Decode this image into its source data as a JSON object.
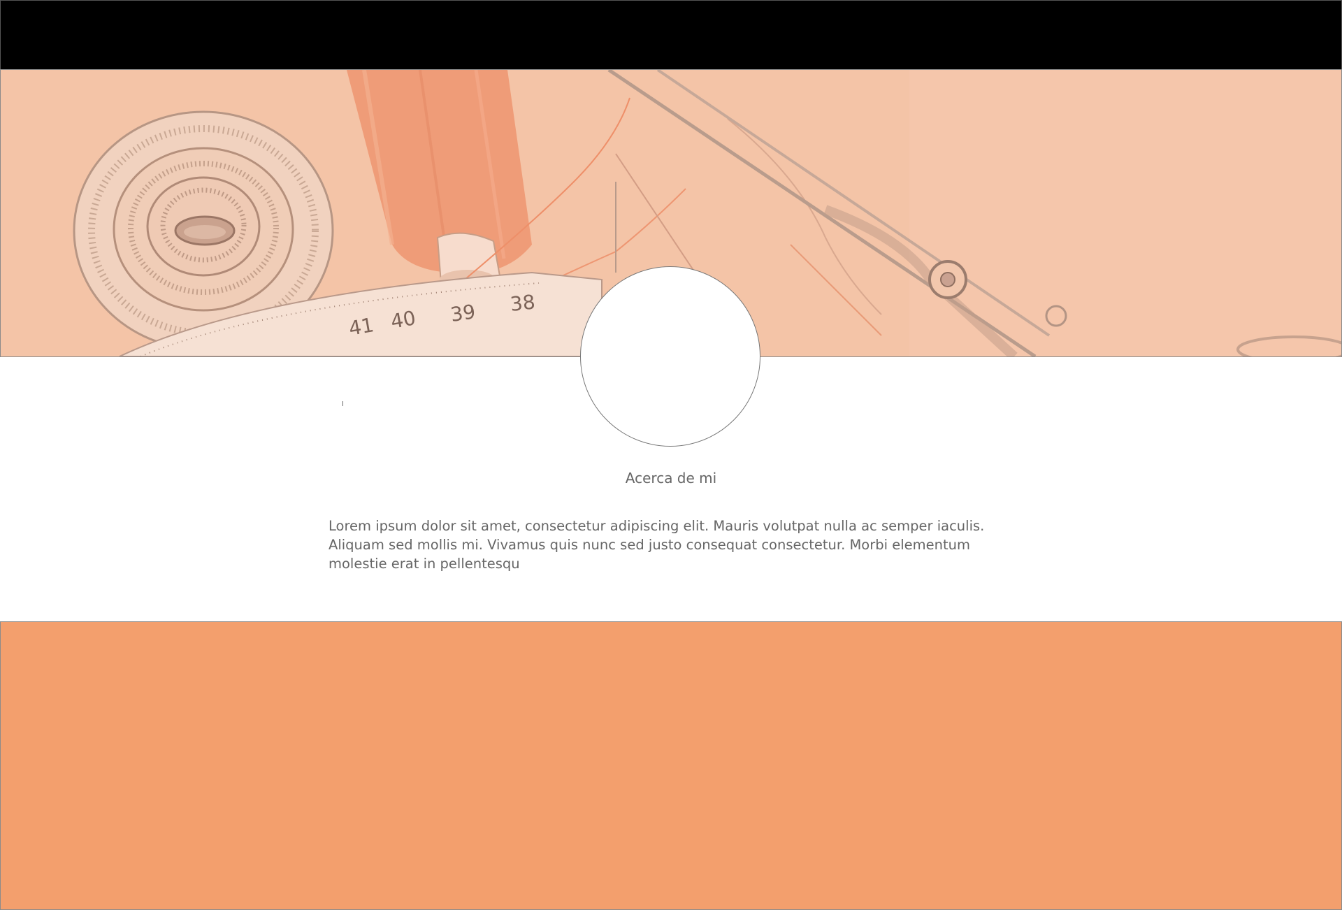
{
  "colors": {
    "top_bar": "#000000",
    "hero_tint": "#f4c4a7",
    "footer": "#f39f6d",
    "text": "#666666"
  },
  "hero": {
    "image": "sewing-supplies-banner",
    "tape_numbers": [
      "38",
      "39",
      "40",
      "41"
    ]
  },
  "about": {
    "title": "Acerca de mi",
    "body": "Lorem ipsum dolor sit amet, consectetur adipiscing elit. Mauris volutpat nulla ac semper iaculis. Aliquam sed mollis mi. Vivamus quis nunc sed justo consequat consectetur. Morbi elementum molestie erat in pellentesqu"
  }
}
